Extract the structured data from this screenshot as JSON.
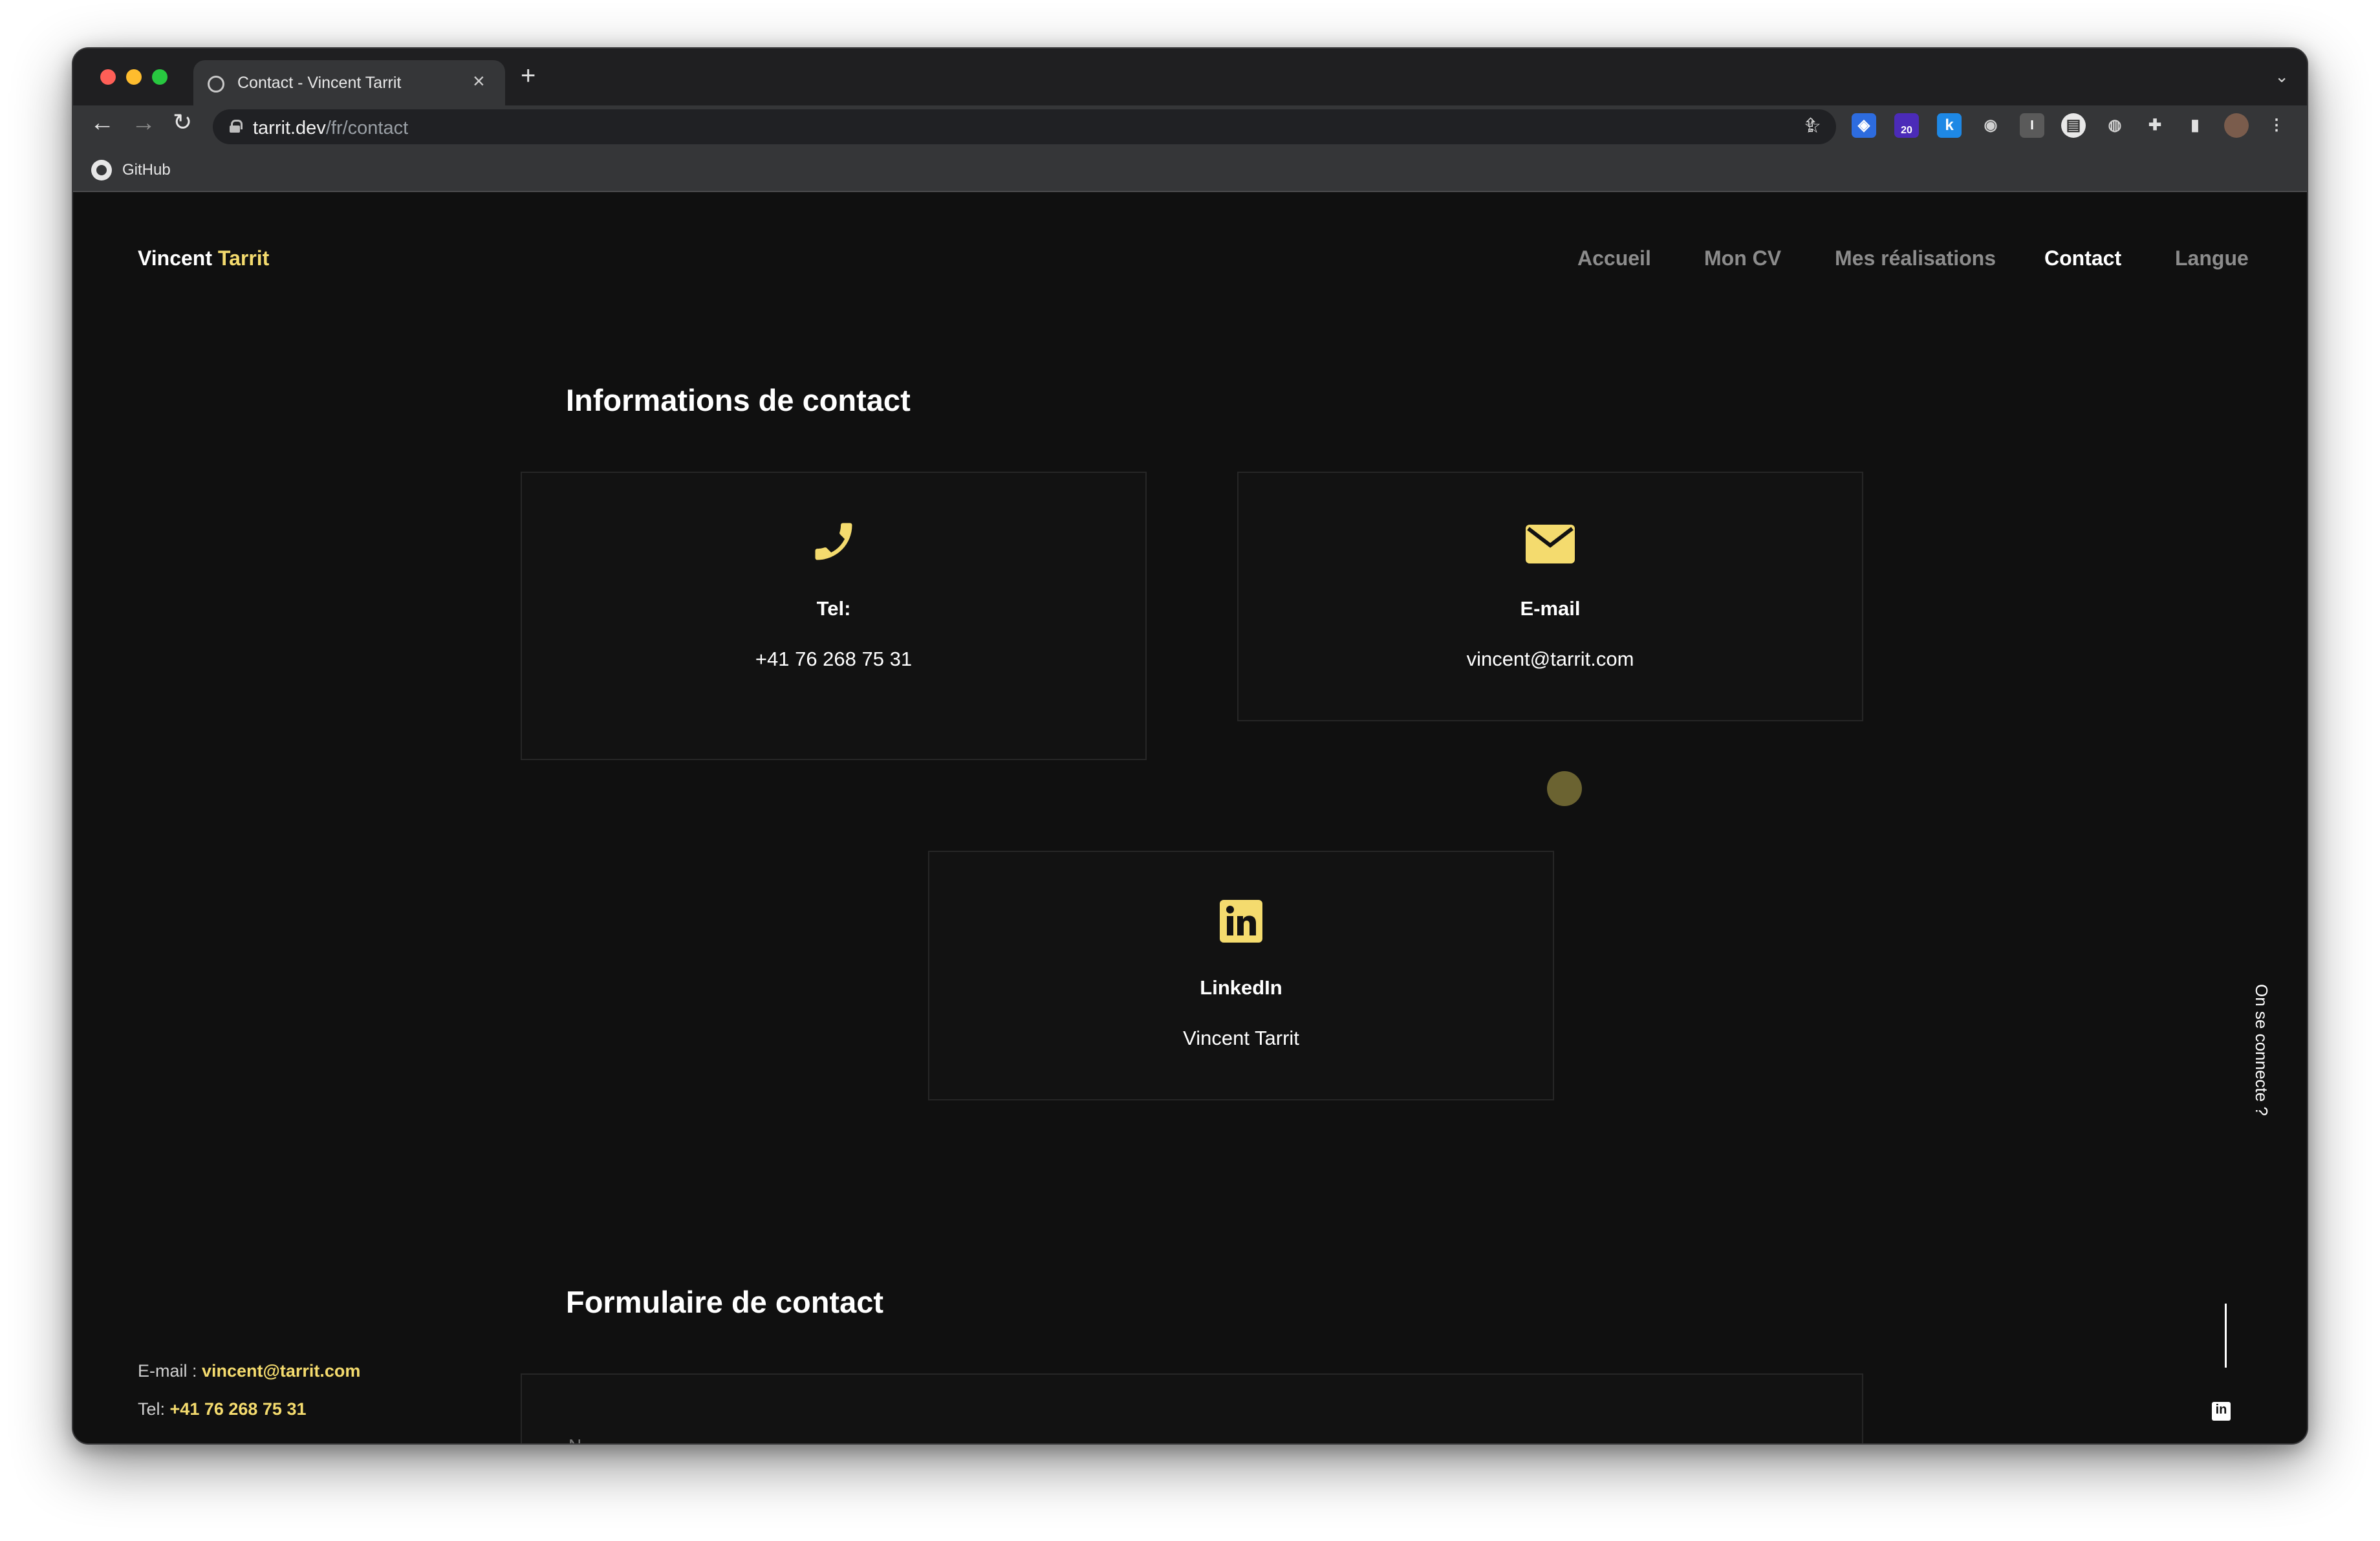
{
  "browser": {
    "tab_title": "Contact - Vincent Tarrit",
    "url_host": "tarrit.dev",
    "url_path": "/fr/contact",
    "bookmark_label": "GitHub",
    "extension_badge": "20"
  },
  "header": {
    "brand_first": "Vincent",
    "brand_last": "Tarrit",
    "nav": [
      "Accueil",
      "Mon CV",
      "Mes réalisations",
      "Contact",
      "Langue"
    ],
    "active_nav": "Contact"
  },
  "contact_info": {
    "title": "Informations de contact",
    "phone": {
      "label": "Tel:",
      "value": "+41 76 268 75 31"
    },
    "email": {
      "label": "E-mail",
      "value": "vincent@tarrit.com"
    },
    "linkedin": {
      "label": "LinkedIn",
      "value": "Vincent Tarrit"
    }
  },
  "side": {
    "vertical_label": "On se connecte ?",
    "email_prefix": "E-mail : ",
    "email_value": "vincent@tarrit.com",
    "tel_prefix": "Tel: ",
    "tel_value": "+41 76 268 75 31"
  },
  "form": {
    "title": "Formulaire de contact",
    "first_field_peek": "N..."
  },
  "colors": {
    "accent": "#f4db6e",
    "background": "#101010",
    "card_border": "#262626"
  }
}
